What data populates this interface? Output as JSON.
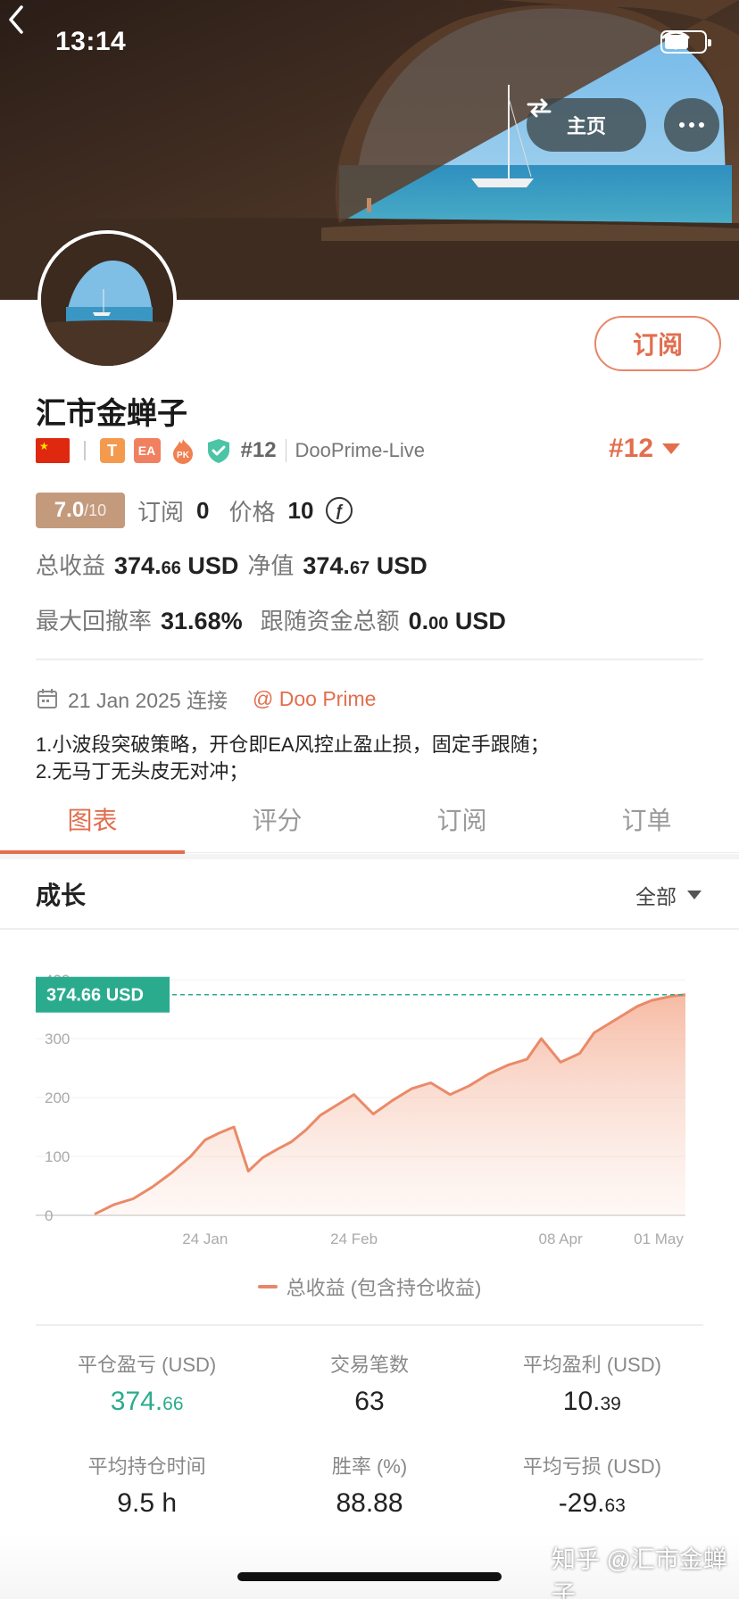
{
  "status": {
    "time": "13:14"
  },
  "header": {
    "home_label": "主页"
  },
  "profile": {
    "name": "汇市金蝉子",
    "badges": {
      "t": "T",
      "ea": "EA",
      "pk": "PK"
    },
    "rank_small": "#12",
    "broker": "DooPrime-Live",
    "rank_big": "#12",
    "subscribe_label": "订阅",
    "score": "7.0",
    "score_max": "/10",
    "subscribe_count_label": "订阅",
    "subscribe_count": "0",
    "price_label": "价格",
    "price": "10",
    "price_icon": "ƒ"
  },
  "stats": {
    "total_profit_label": "总收益",
    "total_profit_int": "374.",
    "total_profit_dec": "66",
    "total_profit_unit": "USD",
    "equity_label": "净值",
    "equity_int": "374.",
    "equity_dec": "67",
    "equity_unit": "USD",
    "max_drawdown_label": "最大回撤率",
    "max_drawdown": "31.68%",
    "follow_label": "跟随资金总额",
    "follow_int": "0.",
    "follow_dec": "00",
    "follow_unit": "USD"
  },
  "connection": {
    "date_text": "21 Jan 2025 连接",
    "broker_link": "@ Doo Prime"
  },
  "description": {
    "line1": "1.小波段突破策略，开仓即EA风控止盈止损，固定手跟随；",
    "line2": "2.无马丁无头皮无对冲；"
  },
  "tabs": [
    {
      "label": "图表"
    },
    {
      "label": "评分"
    },
    {
      "label": "订阅"
    },
    {
      "label": "订单"
    }
  ],
  "growth": {
    "title": "成长",
    "filter": "全部"
  },
  "chart_data": {
    "type": "area",
    "series": [
      {
        "name": "总收益 (包含持仓收益)",
        "x": [
          "2025-01-01",
          "2025-01-05",
          "2025-01-09",
          "2025-01-13",
          "2025-01-17",
          "2025-01-21",
          "2025-01-24",
          "2025-01-27",
          "2025-01-30",
          "2025-02-02",
          "2025-02-05",
          "2025-02-08",
          "2025-02-11",
          "2025-02-14",
          "2025-02-17",
          "2025-02-20",
          "2025-02-24",
          "2025-02-28",
          "2025-03-04",
          "2025-03-08",
          "2025-03-12",
          "2025-03-16",
          "2025-03-20",
          "2025-03-24",
          "2025-03-28",
          "2025-04-01",
          "2025-04-04",
          "2025-04-08",
          "2025-04-12",
          "2025-04-15",
          "2025-04-18",
          "2025-04-21",
          "2025-04-24",
          "2025-04-27",
          "2025-05-01",
          "2025-05-04"
        ],
        "values": [
          2,
          18,
          28,
          48,
          72,
          100,
          128,
          140,
          150,
          75,
          98,
          112,
          125,
          145,
          170,
          185,
          205,
          172,
          195,
          215,
          225,
          205,
          220,
          240,
          255,
          265,
          300,
          260,
          275,
          310,
          325,
          340,
          355,
          365,
          372,
          374.66
        ]
      }
    ],
    "x_ticks": [
      "24 Jan",
      "24 Feb",
      "08 Apr",
      "01 May"
    ],
    "y_ticks": [
      0,
      100,
      200,
      300,
      400
    ],
    "ylim": [
      0,
      400
    ],
    "current_label": "374.66 USD",
    "grid": true,
    "legend": "bottom-center"
  },
  "legend": {
    "label": "总收益 (包含持仓收益)"
  },
  "metrics": [
    {
      "label": "平仓盈亏 (USD)",
      "int": "374.",
      "dec": "66"
    },
    {
      "label": "交易笔数",
      "int": "63",
      "dec": ""
    },
    {
      "label": "平均盈利 (USD)",
      "int": "10.",
      "dec": "39"
    },
    {
      "label": "平均持仓时间",
      "int": "9.5 h",
      "dec": ""
    },
    {
      "label": "胜率 (%)",
      "int": "88.88",
      "dec": ""
    },
    {
      "label": "平均亏损 (USD)",
      "int": "-29.",
      "dec": "63"
    }
  ],
  "watermark": "知乎 @汇市金蝉子",
  "colors": {
    "accent": "#e26e4e",
    "green": "#2bab8e",
    "score_bg": "#c49a7d"
  }
}
